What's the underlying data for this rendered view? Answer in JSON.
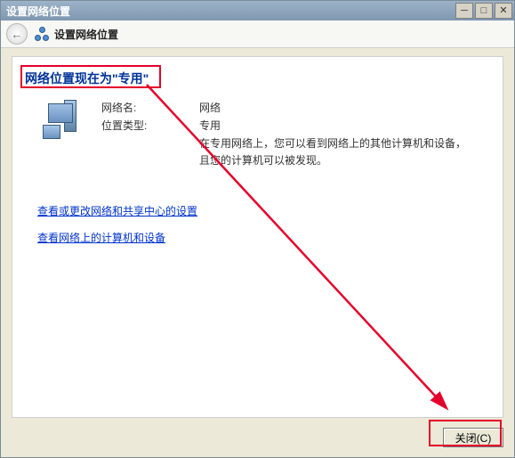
{
  "titlebar": {
    "caption": "设置网络位置"
  },
  "header": {
    "title": "设置网络位置"
  },
  "content": {
    "heading": "网络位置现在为\"专用\"",
    "name_label": "网络名:",
    "name_value": "网络",
    "type_label": "位置类型:",
    "type_value": "专用",
    "description": "在专用网络上，您可以看到网络上的其他计算机和设备，且您的计算机可以被发现。",
    "link_sharing": "查看或更改网络和共享中心的设置",
    "link_devices": "查看网络上的计算机和设备"
  },
  "footer": {
    "close_label": "关闭(C)"
  }
}
